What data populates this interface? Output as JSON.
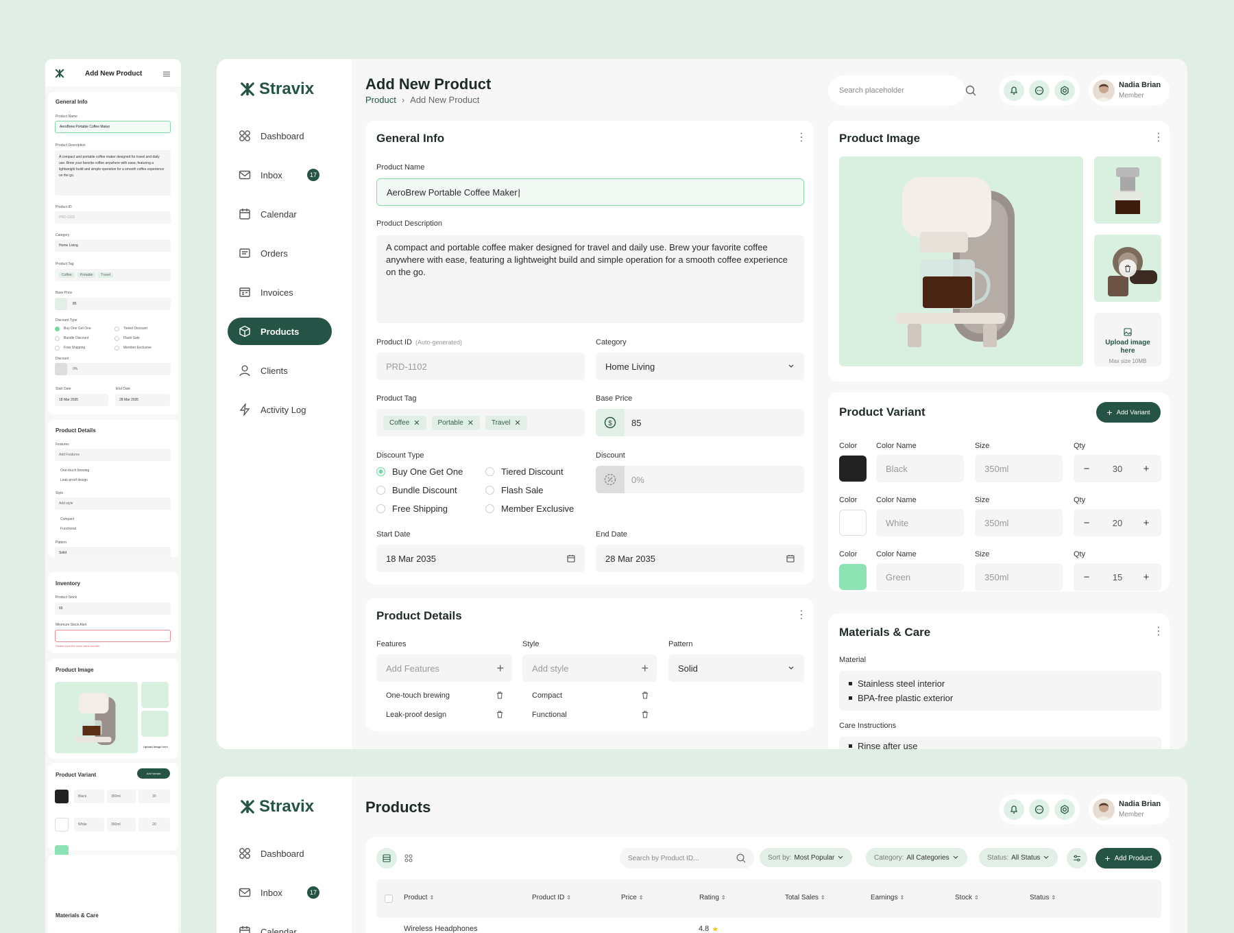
{
  "brand": {
    "name": "Stravix"
  },
  "colors": {
    "primary": "#255446",
    "accent": "#6fdba0",
    "bg": "#e1eee5",
    "swatch_black": "#222222",
    "swatch_white": "#ffffff",
    "swatch_green": "#8ee3b5"
  },
  "sidebar": {
    "items": [
      {
        "label": "Dashboard",
        "icon": "dashboard-icon"
      },
      {
        "label": "Inbox",
        "icon": "inbox-icon",
        "badge": "17"
      },
      {
        "label": "Calendar",
        "icon": "calendar-icon"
      },
      {
        "label": "Orders",
        "icon": "orders-icon"
      },
      {
        "label": "Invoices",
        "icon": "invoices-icon"
      },
      {
        "label": "Products",
        "icon": "products-icon",
        "active": true
      },
      {
        "label": "Clients",
        "icon": "clients-icon"
      },
      {
        "label": "Activity Log",
        "icon": "activity-icon"
      }
    ]
  },
  "header": {
    "title": "Add New Product",
    "breadcrumb": {
      "root": "Product",
      "current": "Add New Product"
    },
    "search_placeholder": "Search placeholder",
    "user": {
      "name": "Nadia Brian",
      "role": "Member"
    }
  },
  "general_info": {
    "title": "General Info",
    "product_name_label": "Product Name",
    "product_name": "AeroBrew Portable Coffee Maker",
    "description_label": "Product Description",
    "description": "A compact and portable coffee maker designed for travel and daily use. Brew your favorite coffee anywhere with ease, featuring a lightweight build and simple operation for a smooth coffee experience on the go.",
    "product_id_label": "Product ID",
    "product_id_note": "(Auto-generated)",
    "product_id": "PRD-1102",
    "category_label": "Category",
    "category": "Home Living",
    "tag_label": "Product Tag",
    "tags": [
      "Coffee",
      "Portable",
      "Travel"
    ],
    "base_price_label": "Base Price",
    "base_price": "85",
    "discount_type_label": "Discount Type",
    "discount_types": [
      "Buy One Get One",
      "Tiered Discount",
      "Bundle Discount",
      "Flash Sale",
      "Free Shipping",
      "Member Exclusive"
    ],
    "discount_type_selected": "Buy One Get One",
    "discount_label": "Discount",
    "discount_placeholder": "0%",
    "start_date_label": "Start Date",
    "start_date": "18 Mar 2035",
    "end_date_label": "End Date",
    "end_date": "28 Mar 2035"
  },
  "product_details": {
    "title": "Product Details",
    "features_label": "Features",
    "features_placeholder": "Add Features",
    "features": [
      "One-touch brewing",
      "Leak-proof design"
    ],
    "style_label": "Style",
    "style_placeholder": "Add style",
    "styles": [
      "Compact",
      "Functional"
    ],
    "pattern_label": "Pattern",
    "pattern": "Solid"
  },
  "product_image": {
    "title": "Product Image",
    "upload_text": "Upload image here",
    "upload_note": "Max size 10MB"
  },
  "product_variant": {
    "title": "Product Variant",
    "add_label": "Add Variant",
    "col_color": "Color",
    "col_name": "Color Name",
    "col_size": "Size",
    "col_qty": "Qty",
    "rows": [
      {
        "name": "Black",
        "size": "350ml",
        "qty": "30"
      },
      {
        "name": "White",
        "size": "350ml",
        "qty": "20"
      },
      {
        "name": "Green",
        "size": "350ml",
        "qty": "15"
      }
    ]
  },
  "materials": {
    "title": "Materials & Care",
    "material_label": "Material",
    "materials": [
      "Stainless steel interior",
      "BPA-free plastic exterior"
    ],
    "care_label": "Care Instructions",
    "care": [
      "Rinse after use"
    ]
  },
  "products_page": {
    "title": "Products",
    "search_placeholder": "Search by Product ID...",
    "sort_key": "Sort by:",
    "sort_val": "Most Popular",
    "cat_key": "Category:",
    "cat_val": "All Categories",
    "status_key": "Status:",
    "status_val": "All Status",
    "add_label": "Add Product",
    "columns": [
      "Product",
      "Product ID",
      "Price",
      "Rating",
      "Total Sales",
      "Earnings",
      "Stock",
      "Status"
    ],
    "first_row": {
      "product": "Wireless Headphones",
      "rating": "4.8"
    }
  },
  "mobile": {
    "title": "Add New Product",
    "inventory_title": "Inventory",
    "stock_label": "Product Stock",
    "stock": "65",
    "min_alert_label": "Minimum Stock Alert",
    "min_alert_error": "Please input the stock value number",
    "category": "Home Living",
    "add_features": "Add Features",
    "add_style": "Add style",
    "discount": "0%"
  }
}
